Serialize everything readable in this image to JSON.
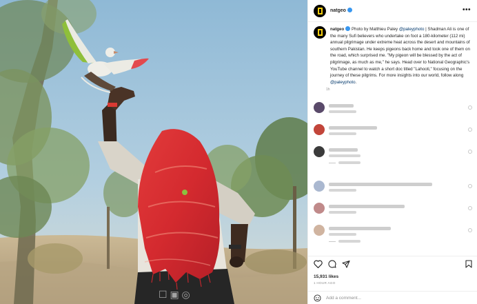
{
  "post": {
    "username": "natgeo",
    "more_icon": "more-horizontal-icon",
    "caption": {
      "username": "natgeo",
      "segments": [
        {
          "text": "Photo by Matthieu Paley ",
          "link": false
        },
        {
          "text": "@paleyphoto",
          "link": true
        },
        {
          "text": " | Shadman Ali is one of the many Sufi believers who undertake on foot a 180-kilometer (112 mi) annual pilgrimage under extreme heat across the desert and mountains of southern Pakistan. He keeps pigeons back home and took one of them on the road, which surprised me. \"My pigeon will be blessed by the act of pilgrimage, as much as me,\" he says. Head over to National Geographic's YouTube channel to watch a short doc titled \"Lahooti,\" focusing on the journey of these pilgrims. For more insights into our world, follow along ",
          "link": false
        },
        {
          "text": "@paleyphoto",
          "link": true
        },
        {
          "text": ".",
          "link": false
        }
      ],
      "time": "1h"
    },
    "likes": "15,931 likes",
    "time_ago": "1 HOUR AGO",
    "comment_placeholder": "Add a comment...",
    "icons": [
      "heart-icon",
      "comment-icon",
      "share-icon",
      "bookmark-icon",
      "emoji-icon"
    ],
    "colors": {
      "brand_yellow": "#f7cf0f",
      "verified": "#3897f0",
      "link": "#00376b",
      "muted": "#8e8e8e"
    }
  }
}
